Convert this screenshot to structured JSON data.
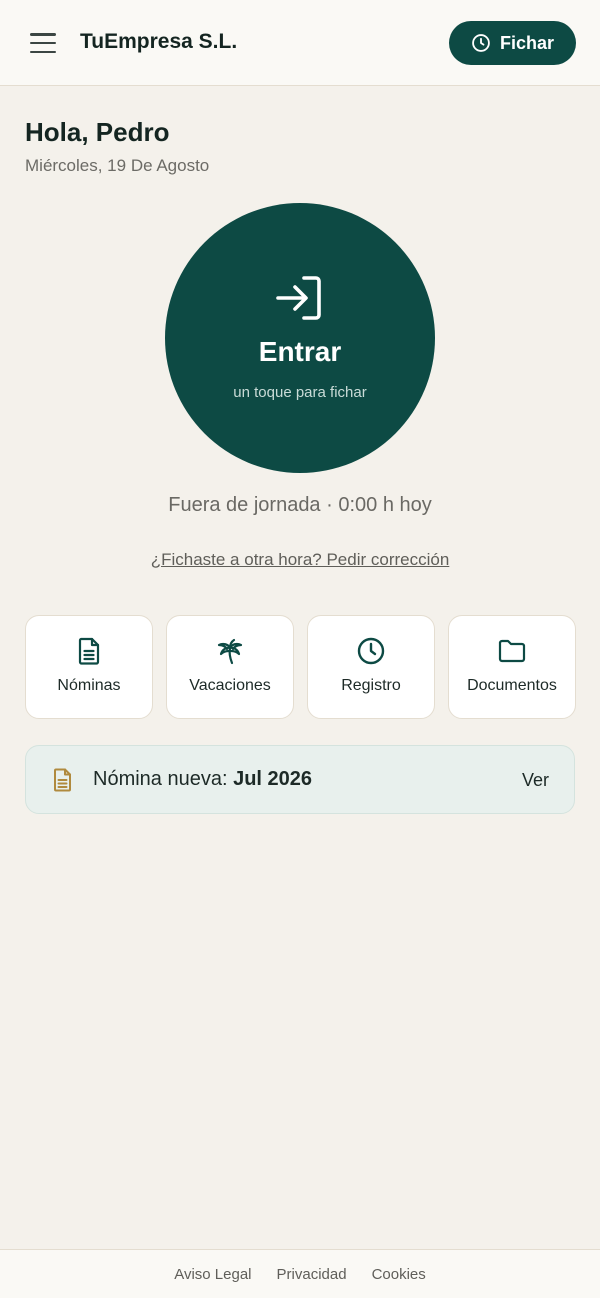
{
  "header": {
    "company": "TuEmpresa S.L.",
    "fichar_label": "Fichar"
  },
  "greeting": {
    "title": "Hola, Pedro",
    "date": "Miércoles, 19 De Agosto"
  },
  "clock_button": {
    "label": "Entrar",
    "sublabel": "un toque para fichar"
  },
  "status": "Fuera de jornada · 0:00 h hoy",
  "correction_link": "¿Fichaste a otra hora? Pedir corrección",
  "cards": [
    {
      "label": "Nóminas",
      "icon": "document-icon"
    },
    {
      "label": "Vacaciones",
      "icon": "palm-tree-icon"
    },
    {
      "label": "Registro",
      "icon": "clock-icon"
    },
    {
      "label": "Documentos",
      "icon": "folder-icon"
    }
  ],
  "notice": {
    "prefix": "Nómina nueva: ",
    "highlight": "Jul 2026",
    "link": "Ver",
    "icon": "document-icon"
  },
  "footer": {
    "legal": "Aviso Legal",
    "privacy": "Privacidad",
    "cookies": "Cookies"
  },
  "colors": {
    "primary": "#0d4a44",
    "background": "#f4f1eb",
    "notice_bg": "#e8f0ed",
    "notice_icon": "#b08a3e"
  }
}
